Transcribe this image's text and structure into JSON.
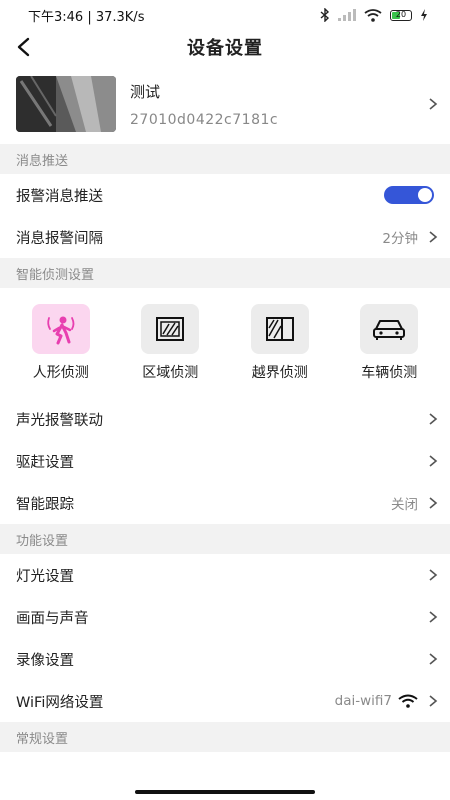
{
  "status": {
    "time": "下午3:46 | 37.3K/s",
    "battery": "20",
    "accent_battery": "#37c24a"
  },
  "header": {
    "title": "设备设置"
  },
  "device": {
    "name": "测试",
    "id": "27010d0422c7181c"
  },
  "sections": {
    "push": "消息推送",
    "detect": "智能侦测设置",
    "function": "功能设置",
    "general": "常规设置"
  },
  "push_rows": [
    {
      "label": "报警消息推送",
      "toggle": true
    },
    {
      "label": "消息报警间隔",
      "value": "2分钟"
    }
  ],
  "detect_items": [
    {
      "label": "人形侦测",
      "icon": "person-detect-icon",
      "active": true
    },
    {
      "label": "区域侦测",
      "icon": "area-detect-icon",
      "active": false
    },
    {
      "label": "越界侦测",
      "icon": "crossline-detect-icon",
      "active": false
    },
    {
      "label": "车辆侦测",
      "icon": "car-detect-icon",
      "active": false
    }
  ],
  "detect_rows": [
    {
      "label": "声光报警联动"
    },
    {
      "label": "驱赶设置"
    },
    {
      "label": "智能跟踪",
      "value": "关闭"
    }
  ],
  "function_rows": [
    {
      "label": "灯光设置"
    },
    {
      "label": "画面与声音"
    },
    {
      "label": "录像设置"
    },
    {
      "label": "WiFi网络设置",
      "value": "dai-wifi7"
    }
  ],
  "colors": {
    "toggle_on": "#3556d8",
    "active_icon_bg": "#fbd6ef",
    "person_icon": "#e83fb0"
  }
}
